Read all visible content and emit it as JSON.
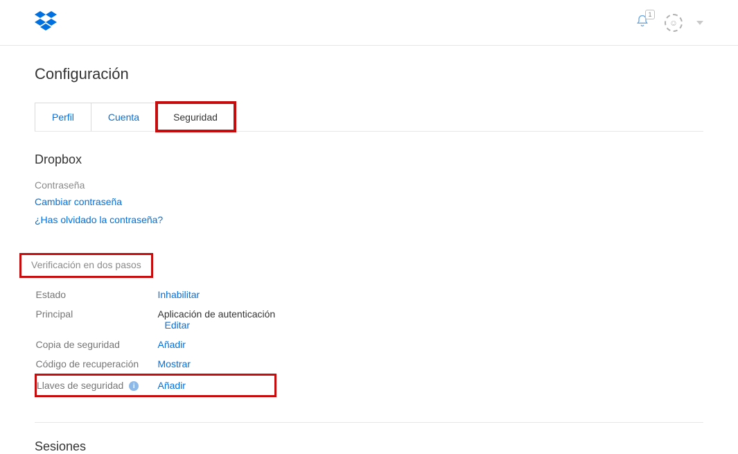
{
  "header": {
    "notification_count": "1"
  },
  "page_title": "Configuración",
  "tabs": {
    "profile": "Perfil",
    "account": "Cuenta",
    "security": "Seguridad"
  },
  "security": {
    "dropbox_heading": "Dropbox",
    "password_label": "Contraseña",
    "change_password": "Cambiar contraseña",
    "forgot_password": "¿Has olvidado la contraseña?",
    "two_step_heading": "Verificación en dos pasos",
    "rows": {
      "status_label": "Estado",
      "status_action": "Inhabilitar",
      "primary_label": "Principal",
      "primary_value": "Aplicación de autenticación",
      "primary_action": "Editar",
      "backup_label": "Copia de seguridad",
      "backup_action": "Añadir",
      "recovery_label": "Código de recuperación",
      "recovery_action": "Mostrar",
      "keys_label": "Llaves de seguridad",
      "keys_action": "Añadir"
    },
    "sessions_heading": "Sesiones"
  }
}
